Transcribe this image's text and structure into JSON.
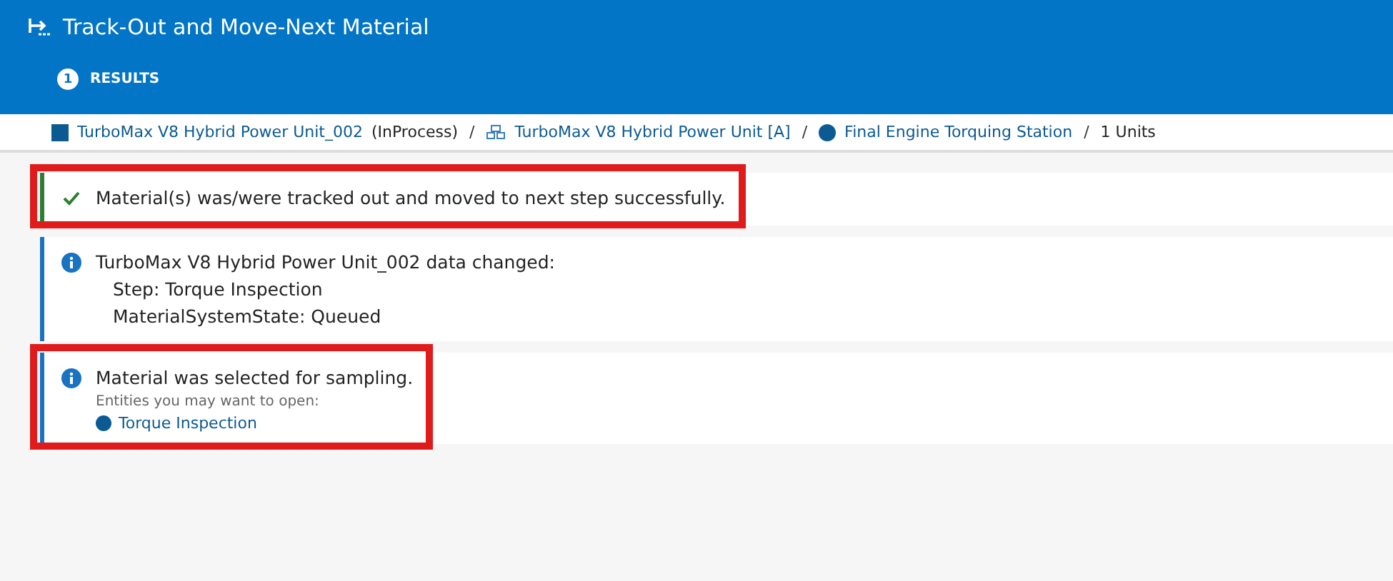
{
  "header": {
    "title": "Track-Out and Move-Next Material",
    "step": {
      "number": "1",
      "label": "RESULTS",
      "selected": true
    }
  },
  "breadcrumb": [
    {
      "kind": "material",
      "text": "TurboMax V8 Hybrid Power Unit_002",
      "state": "(InProcess)"
    },
    {
      "kind": "product",
      "separator": "/",
      "text": "TurboMax V8 Hybrid Power Unit [A]"
    },
    {
      "kind": "resource",
      "separator": "/",
      "text": "Final Engine Torquing Station"
    },
    {
      "kind": "plain",
      "separator": "/",
      "text": "1 Units"
    }
  ],
  "messages": [
    {
      "kind": "success",
      "highlighted": true,
      "text": "Material(s) was/were tracked out and moved to next step successfully."
    },
    {
      "kind": "info",
      "highlighted": false,
      "text": "TurboMax V8 Hybrid Power Unit_002 data changed:",
      "details": [
        "Step: Torque Inspection",
        "MaterialSystemState: Queued"
      ]
    },
    {
      "kind": "info",
      "highlighted": true,
      "text": "Material was selected for sampling.",
      "hint": "Entities you may want to open:",
      "link": "Torque Inspection"
    }
  ]
}
